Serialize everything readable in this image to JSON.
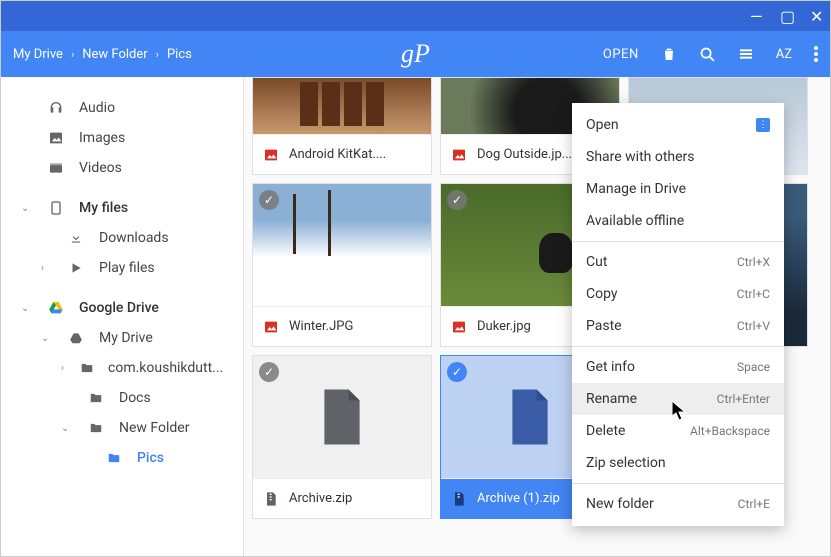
{
  "titlebar": {
    "min": "—",
    "max": "▢",
    "close": "✕"
  },
  "breadcrumb": [
    "My Drive",
    "New Folder",
    "Pics"
  ],
  "logo": "gP",
  "toolbar": {
    "open": "OPEN"
  },
  "sidebar": {
    "audio": "Audio",
    "images": "Images",
    "videos": "Videos",
    "myfiles": "My files",
    "downloads": "Downloads",
    "playfiles": "Play files",
    "gdrive": "Google Drive",
    "mydrive": "My Drive",
    "com": "com.koushikdutt...",
    "docs": "Docs",
    "newfolder": "New Folder",
    "pics": "Pics"
  },
  "files": [
    {
      "name": "Android KitKat....",
      "type": "image",
      "thumb": "kitkat"
    },
    {
      "name": "Dog Outside.jp...",
      "type": "image",
      "thumb": "dog1"
    },
    {
      "name": "",
      "type": "image",
      "thumb": "sky",
      "nocaption": true
    },
    {
      "name": "Winter.JPG",
      "type": "image",
      "thumb": "winter",
      "selected_badge": true
    },
    {
      "name": "Duker.jpg",
      "type": "image",
      "thumb": "grass",
      "selected_badge": true
    },
    {
      "name": "",
      "type": "image",
      "thumb": "mountain",
      "nocaption": true,
      "selected_badge": true
    },
    {
      "name": "Archive.zip",
      "type": "zip",
      "thumb": "zipgray",
      "selected_badge": true
    },
    {
      "name": "Archive (1).zip",
      "type": "zip",
      "thumb": "zipblue",
      "selected_badge": true,
      "selected": true
    },
    {
      "name": "",
      "type": "blank",
      "thumb": ""
    }
  ],
  "context_menu": [
    {
      "label": "Open",
      "icon": true
    },
    {
      "label": "Share with others"
    },
    {
      "label": "Manage in Drive"
    },
    {
      "label": "Available offline"
    },
    {
      "sep": true
    },
    {
      "label": "Cut",
      "shortcut": "Ctrl+X"
    },
    {
      "label": "Copy",
      "shortcut": "Ctrl+C"
    },
    {
      "label": "Paste",
      "shortcut": "Ctrl+V"
    },
    {
      "sep": true
    },
    {
      "label": "Get info",
      "shortcut": "Space"
    },
    {
      "label": "Rename",
      "shortcut": "Ctrl+Enter",
      "hovered": true
    },
    {
      "label": "Delete",
      "shortcut": "Alt+Backspace"
    },
    {
      "label": "Zip selection"
    },
    {
      "sep": true
    },
    {
      "label": "New folder",
      "shortcut": "Ctrl+E"
    }
  ]
}
